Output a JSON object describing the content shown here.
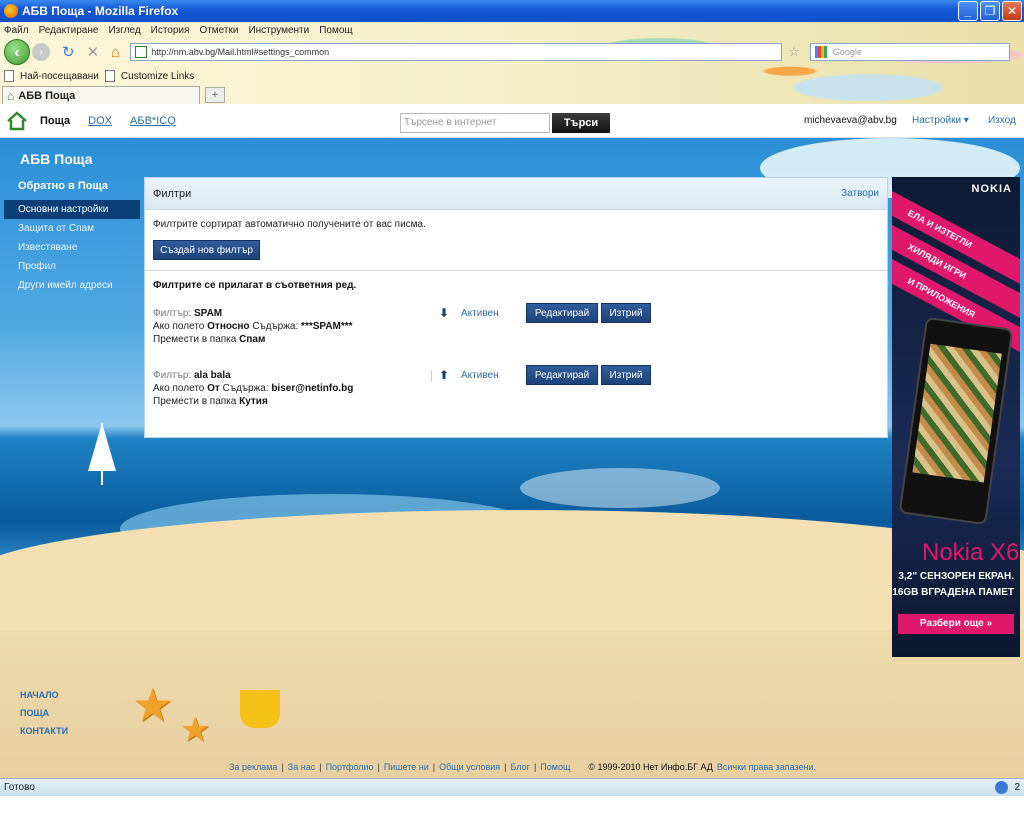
{
  "window": {
    "title": "АБВ Поща - Mozilla Firefox"
  },
  "browser": {
    "menu": [
      "Файл",
      "Редактиране",
      "Изглед",
      "История",
      "Отметки",
      "Инструменти",
      "Помощ"
    ],
    "url": "http://nm.abv.bg/Mail.html#settings_common",
    "search_placeholder": "Google",
    "bookmarks": [
      "Най-посещавани",
      "Customize Links"
    ],
    "tab_title": "АБВ Поща",
    "newtab_label": "+"
  },
  "header": {
    "brand": "Поща",
    "links": [
      "DOX",
      "АБВ*ICQ"
    ],
    "search_placeholder": "Търсене в интернет",
    "search_button": "Търси",
    "email": "michevaeva@abv.bg",
    "settings": "Настройки ▾",
    "logout": "Изход"
  },
  "sidebar": {
    "title": "АБВ Поща",
    "back": "Обратно в Поща",
    "items": [
      "Основни настройки",
      "Защита от Спам",
      "Известяване",
      "Профил",
      "Други имейл адреси"
    ]
  },
  "panel": {
    "title": "Филтри",
    "close": "Затвори",
    "description": "Филтрите сортират автоматично получените от вас писма.",
    "create_button": "Създай нов филтър",
    "order_note": "Филтрите се прилагат в съответния ред.",
    "filter_label": "Филтър:",
    "if_field": "Ако полето",
    "contains": "Съдържа:",
    "move_to": "Премести в папка",
    "edit_button": "Редактирай",
    "delete_button": "Изтрий",
    "filters": [
      {
        "name": "SPAM",
        "field": "Относно",
        "value": "***SPAM***",
        "folder": "Спам",
        "arrow": "⬇",
        "status": "Активен"
      },
      {
        "name": "ala bala",
        "field": "От",
        "value": "biser@netinfo.bg",
        "folder": "Кутия",
        "arrow": "⬆",
        "status": "Активен"
      }
    ]
  },
  "ad": {
    "brand": "NOKIA",
    "bands": [
      "ЕЛА И ИЗТЕГЛИ",
      "ХИЛЯДИ ИГРИ",
      "И ПРИЛОЖЕНИЯ"
    ],
    "model": "Nokia X6",
    "line1": "3,2\" СЕНЗОРЕН ЕКРАН.",
    "line2": "16GB ВГРАДЕНА ПАМЕТ",
    "cta": "Разбери още »"
  },
  "footer": {
    "side_links": [
      "НАЧАЛО",
      "ПОЩА",
      "КОНТАКТИ"
    ],
    "links": [
      "За реклама",
      "За нас",
      "Портфолио",
      "Пишете ни",
      "Общи условия",
      "Блог",
      "Помощ"
    ],
    "copyright": "© 1999-2010 Нет Инфо.БГ АД",
    "rights": "Всички права запазени."
  },
  "status": {
    "text": "Готово",
    "count": "2"
  },
  "colors": {
    "accent": "#2a6fb3",
    "button": "#1f437a",
    "ad_pink": "#e0186b"
  }
}
